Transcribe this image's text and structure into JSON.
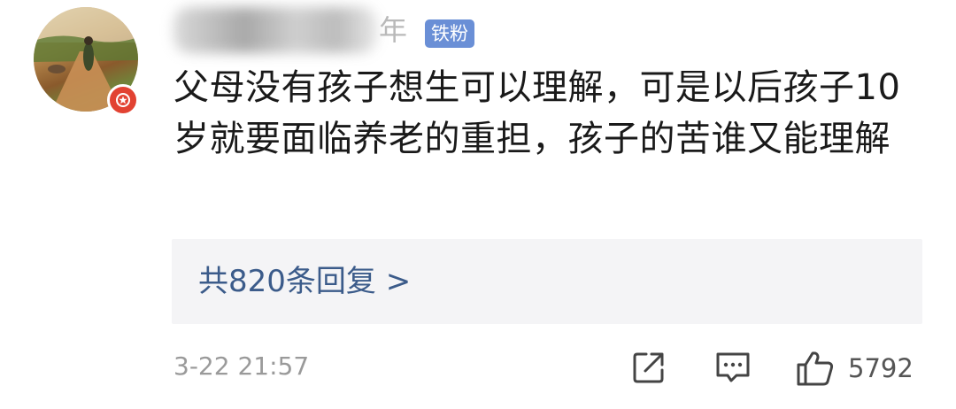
{
  "comment": {
    "username_visible_suffix": "年",
    "fan_badge": "铁粉",
    "text": "父母没有孩子想生可以理解，可是以后孩子10岁就要面临养老的重担，孩子的苦谁又能理解",
    "replies_link": "共820条回复 >",
    "timestamp": "3-22 21:57",
    "like_count": "5792"
  },
  "icons": {
    "avatar_badge": "vip-star-icon",
    "share": "share-icon",
    "comment": "comment-icon",
    "like": "thumbs-up-icon"
  },
  "colors": {
    "fan_badge_bg": "#6a8fd6",
    "link": "#3b5b8a",
    "vip_badge": "#e24232",
    "meta_text": "#9a9a9a"
  }
}
